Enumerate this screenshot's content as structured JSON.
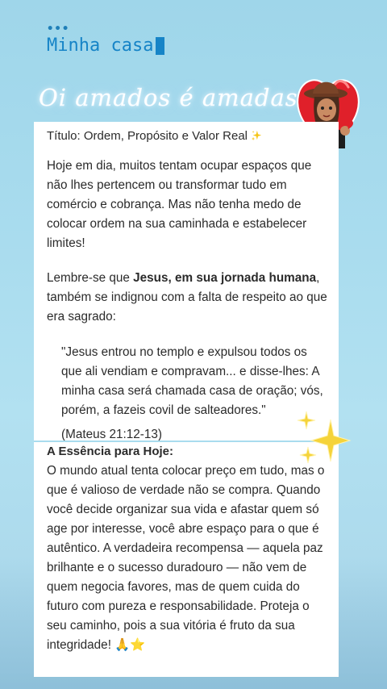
{
  "header": {
    "dots": "•••",
    "title": "Minha casa"
  },
  "overlay": {
    "greeting": "Oi amados é amadas"
  },
  "card1": {
    "title": "Título: Ordem, Propósito e Valor Real",
    "para1": "Hoje em dia, muitos tentam ocupar espaços que não lhes pertencem ou transformar tudo em comércio e cobrança. Mas não tenha medo de colocar ordem na sua caminhada e estabelecer limites!",
    "para2_start": "Lembre-se que ",
    "para2_bold": "Jesus, em sua jornada humana",
    "para2_end": ", também se indignou com a falta de respeito ao que era sagrado:",
    "quote": "\"Jesus entrou no templo e expulsou todos os que ali vendiam e compravam... e disse-lhes: A minha casa será chamada casa de oração; vós, porém, a fazeis covil de salteadores.\"",
    "reference": "(Mateus 21:12-13)"
  },
  "card2": {
    "heading": "A Essência para Hoje:",
    "body": "O mundo atual tenta colocar preço em tudo, mas o que é valioso de verdade não se compra. Quando você decide organizar sua vida e afastar quem só age por interesse, você abre espaço para o que é autêntico. A verdadeira recompensa — aquela paz brilhante e o sucesso duradouro — não vem de quem negocia favores, mas de quem cuida do futuro com pureza e responsabilidade. Proteja o seu caminho, pois a sua vitória é fruto da sua integridade!",
    "end_emoji": "🙏⭐"
  },
  "colors": {
    "background": "#a9dcee",
    "accent_text": "#1684c7",
    "card": "#ffffff",
    "sparkle": "#f5d33a",
    "heart": "#e0202a"
  },
  "icons": {
    "title_sparkle": "sparkles-icon",
    "sticker": "avatar-heart-sticker",
    "deco": "sparkles-icon"
  }
}
